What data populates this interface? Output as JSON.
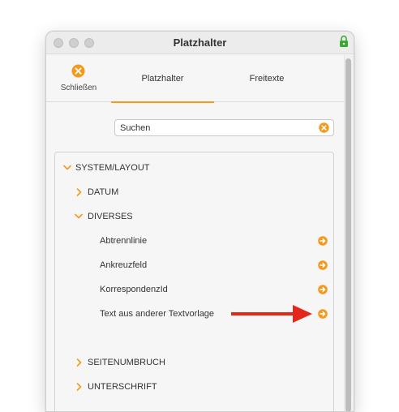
{
  "window": {
    "title": "Platzhalter"
  },
  "tabs": {
    "close_label": "Schließen",
    "items": [
      {
        "label": "Platzhalter",
        "active": true
      },
      {
        "label": "Freitexte",
        "active": false
      }
    ]
  },
  "search": {
    "value": "Suchen"
  },
  "tree": {
    "system_layout": "SYSTEM/LAYOUT",
    "datum": "DATUM",
    "diverses": "DIVERSES",
    "leaves": [
      "Abtrennlinie",
      "Ankreuzfeld",
      "KorrespondenzId",
      "Text aus anderer Textvorlage"
    ],
    "seitenumbruch": "SEITENUMBRUCH",
    "unterschrift": "UNTERSCHRIFT"
  },
  "colors": {
    "accent": "#f39a1e",
    "annotation_arrow": "#e3281b",
    "lock": "#3aaa35"
  },
  "icons": [
    "lock-icon",
    "close-circle-icon",
    "clear-search-icon",
    "chevron-down-icon",
    "chevron-right-icon",
    "arrow-right-circle-icon"
  ]
}
